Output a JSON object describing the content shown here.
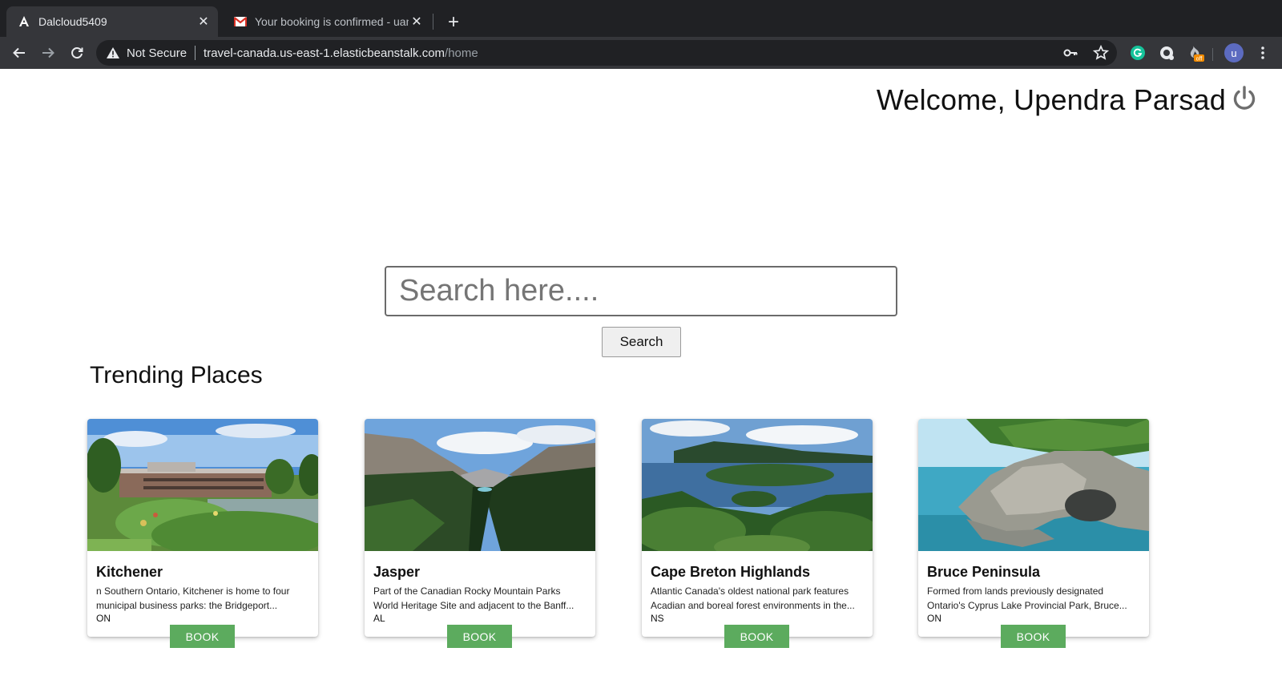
{
  "browser": {
    "tabs": [
      {
        "title": "Dalcloud5409",
        "active": true,
        "icon": "angular-icon"
      },
      {
        "title": "Your booking is confirmed - uant",
        "active": false,
        "icon": "gmail-icon"
      }
    ],
    "address": {
      "security_label": "Not Secure",
      "host": "travel-canada.us-east-1.elasticbeanstalk.com",
      "path": "/home"
    },
    "extension_badge": "off",
    "avatar_letter": "u"
  },
  "header": {
    "welcome": "Welcome, Upendra Parsad"
  },
  "search": {
    "placeholder": "Search here....",
    "button_label": "Search"
  },
  "trending": {
    "title": "Trending Places",
    "places": [
      {
        "name": "Kitchener",
        "description": "n Southern Ontario, Kitchener is home to four municipal business parks: the Bridgeport...",
        "province": "ON",
        "book_label": "BOOK"
      },
      {
        "name": "Jasper",
        "description": "Part of the Canadian Rocky Mountain Parks World Heritage Site and adjacent to the Banff...",
        "province": "AL",
        "book_label": "BOOK"
      },
      {
        "name": "Cape Breton Highlands",
        "description": "Atlantic Canada's oldest national park features Acadian and boreal forest environments in the...",
        "province": "NS",
        "book_label": "BOOK"
      },
      {
        "name": "Bruce Peninsula",
        "description": "Formed from lands previously designated Ontario's Cyprus Lake Provincial Park, Bruce...",
        "province": "ON",
        "book_label": "BOOK"
      }
    ]
  },
  "colors": {
    "book_button": "#5cab5e",
    "chrome_dark": "#202124",
    "chrome_toolbar": "#35363a"
  }
}
